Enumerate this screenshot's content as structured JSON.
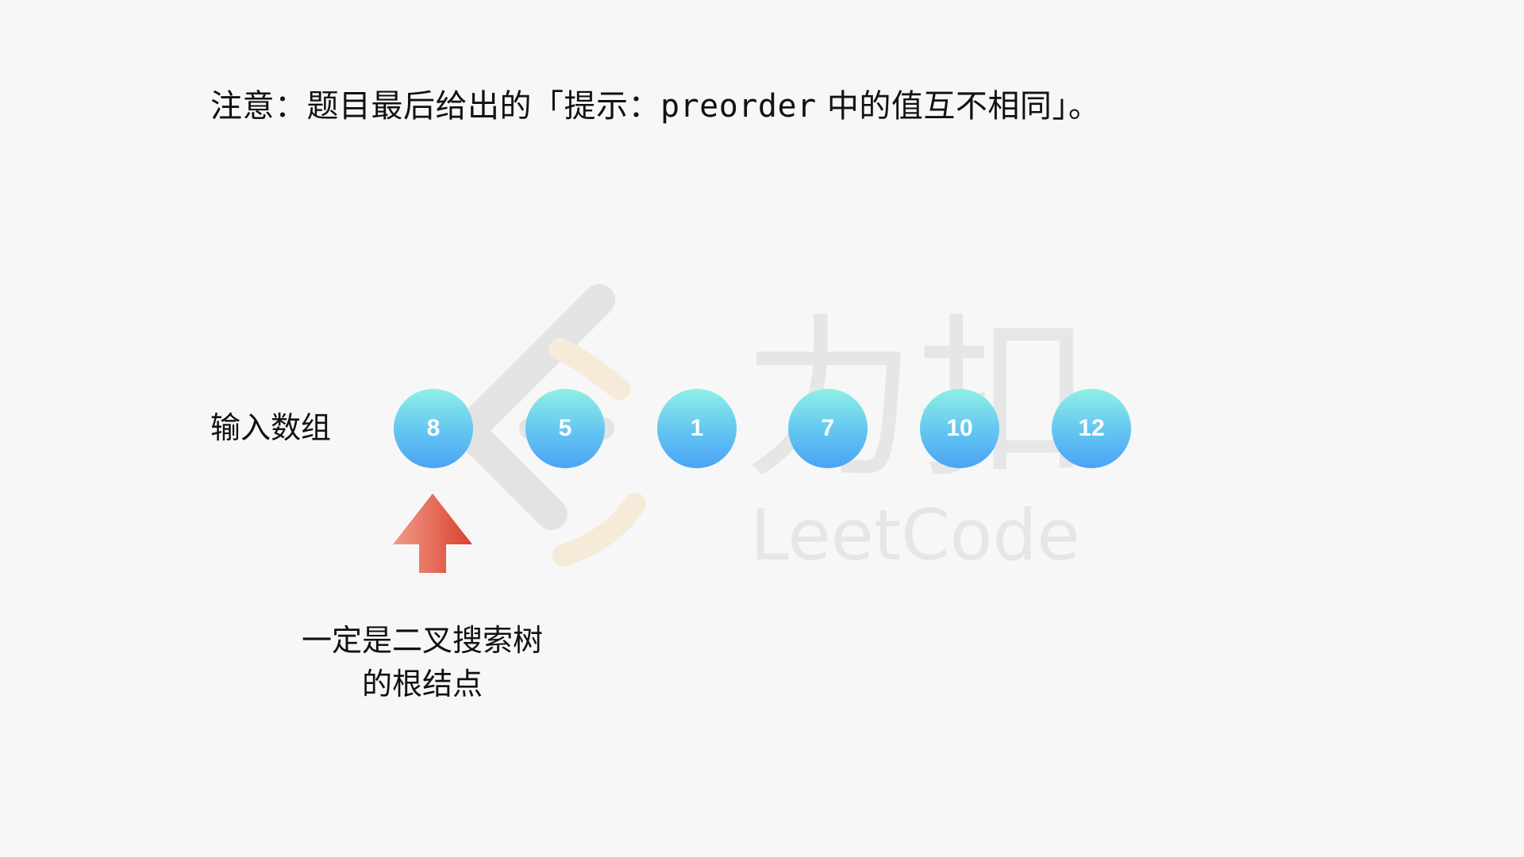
{
  "note": {
    "prefix": "注意：题目最后给出的「提示：",
    "code": "preorder",
    "suffix": " 中的值互不相同」。"
  },
  "watermark": {
    "brand_cn": "力扣",
    "brand_en": "LeetCode",
    "color_gray": "#e3e3e3",
    "color_orange": "#f6ead8"
  },
  "input_array": {
    "label": "输入数组",
    "values": [
      "8",
      "5",
      "1",
      "7",
      "10",
      "12"
    ]
  },
  "arrow": {
    "color_light": "#f39a8a",
    "color_dark": "#d9412e"
  },
  "caption": {
    "line1": "一定是二叉搜索树",
    "line2": "的根结点"
  },
  "colors": {
    "node_top": "#8ff0e6",
    "node_bottom": "#4aa3f5",
    "background": "#f7f7f7"
  }
}
